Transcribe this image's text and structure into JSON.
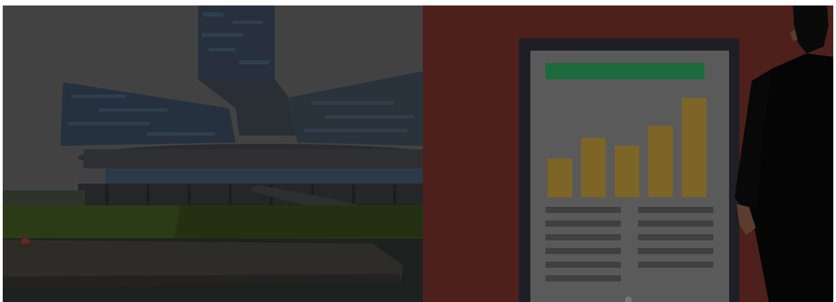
{
  "banner": {
    "left_image": "office-building-photo",
    "right_image": "presentation-illustration"
  },
  "colors": {
    "sky": "#414141",
    "building_glass": "#25303d",
    "lawn": "#2a3a15",
    "water": "#1e2220",
    "right_background": "#4d201c",
    "board_frame": "#1e1f26",
    "board_screen": "#595959",
    "header_bar": "#1d6a3c",
    "chart_bars": "#7d6427",
    "text_lines": "#3f3f3f",
    "suit": "#050505",
    "skin": "#5a3d2c"
  },
  "illustration_chart": {
    "type": "bar",
    "values": [
      0.39,
      0.6,
      0.52,
      0.72,
      1.0
    ]
  }
}
